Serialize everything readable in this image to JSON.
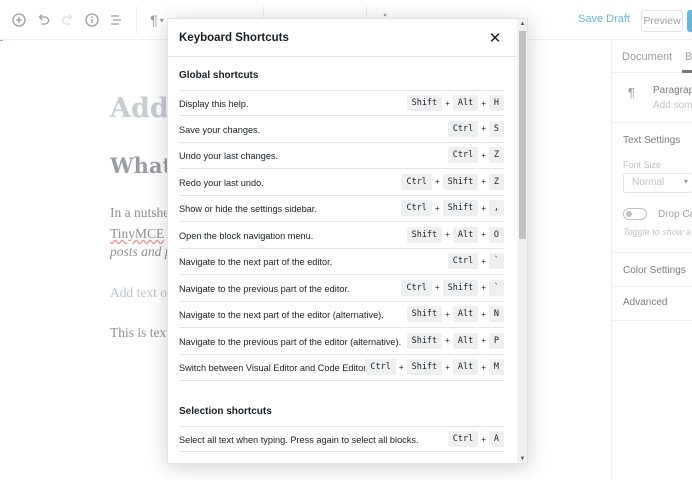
{
  "toolbar": {
    "save_draft": "Save Draft",
    "preview": "Preview"
  },
  "editor": {
    "title": "Add",
    "heading": "What",
    "p1": "In a nutshe",
    "p2_link": "TinyMCE",
    "p2_rest": " e",
    "p3": "posts and p",
    "placeholder": "Add text or",
    "p4": "This is text"
  },
  "sidebar": {
    "tab_document": "Document",
    "tab_block": "Bl",
    "block_name": "Paragraph",
    "block_desc": "Add some",
    "text_settings": "Text Settings",
    "font_size_label": "Font Size",
    "font_size_value": "Normal",
    "drop_cap": "Drop Cap",
    "drop_cap_help": "Toggle to show a l",
    "color_settings": "Color Settings",
    "advanced": "Advanced"
  },
  "modal": {
    "title": "Keyboard Shortcuts",
    "sections": [
      {
        "title": "Global shortcuts",
        "shortcuts": [
          {
            "label": "Display this help.",
            "keys": [
              "Shift",
              "Alt",
              "H"
            ]
          },
          {
            "label": "Save your changes.",
            "keys": [
              "Ctrl",
              "S"
            ]
          },
          {
            "label": "Undo your last changes.",
            "keys": [
              "Ctrl",
              "Z"
            ]
          },
          {
            "label": "Redo your last undo.",
            "keys": [
              "Ctrl",
              "Shift",
              "Z"
            ]
          },
          {
            "label": "Show or hide the settings sidebar.",
            "keys": [
              "Ctrl",
              "Shift",
              ","
            ]
          },
          {
            "label": "Open the block navigation menu.",
            "keys": [
              "Shift",
              "Alt",
              "O"
            ]
          },
          {
            "label": "Navigate to the next part of the editor.",
            "keys": [
              "Ctrl",
              "`"
            ]
          },
          {
            "label": "Navigate to the previous part of the editor.",
            "keys": [
              "Ctrl",
              "Shift",
              "`"
            ]
          },
          {
            "label": "Navigate to the next part of the editor (alternative).",
            "keys": [
              "Shift",
              "Alt",
              "N"
            ]
          },
          {
            "label": "Navigate to the previous part of the editor (alternative).",
            "keys": [
              "Shift",
              "Alt",
              "P"
            ]
          },
          {
            "label": "Switch between Visual Editor and Code Editor.",
            "keys": [
              "Ctrl",
              "Shift",
              "Alt",
              "M"
            ]
          }
        ]
      },
      {
        "title": "Selection shortcuts",
        "shortcuts": [
          {
            "label": "Select all text when typing. Press again to select all blocks.",
            "keys": [
              "Ctrl",
              "A"
            ]
          }
        ]
      }
    ]
  }
}
